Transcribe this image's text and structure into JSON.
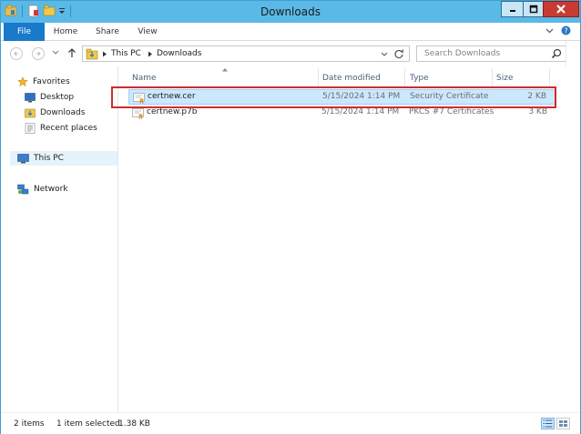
{
  "window": {
    "title": "Downloads",
    "accent_color": "#5ab9e6",
    "close_color": "#c73c32"
  },
  "ribbon": {
    "tabs": [
      {
        "label": "File"
      },
      {
        "label": "Home"
      },
      {
        "label": "Share"
      },
      {
        "label": "View"
      }
    ]
  },
  "address": {
    "crumbs": [
      "This PC",
      "Downloads"
    ],
    "search_placeholder": "Search Downloads"
  },
  "nav": {
    "favorites": "Favorites",
    "desktop": "Desktop",
    "downloads": "Downloads",
    "recent": "Recent places",
    "this_pc": "This PC",
    "network": "Network"
  },
  "columns": {
    "name": "Name",
    "date": "Date modified",
    "type": "Type",
    "size": "Size"
  },
  "files": [
    {
      "name": "certnew.cer",
      "date": "5/15/2024 1:14 PM",
      "type": "Security Certificate",
      "size": "2 KB",
      "selected": true
    },
    {
      "name": "certnew.p7b",
      "date": "5/15/2024 1:14 PM",
      "type": "PKCS #7 Certificates",
      "size": "3 KB",
      "selected": false
    }
  ],
  "status": {
    "count": "2 items",
    "selection": "1 item selected",
    "size": "1.38 KB"
  }
}
